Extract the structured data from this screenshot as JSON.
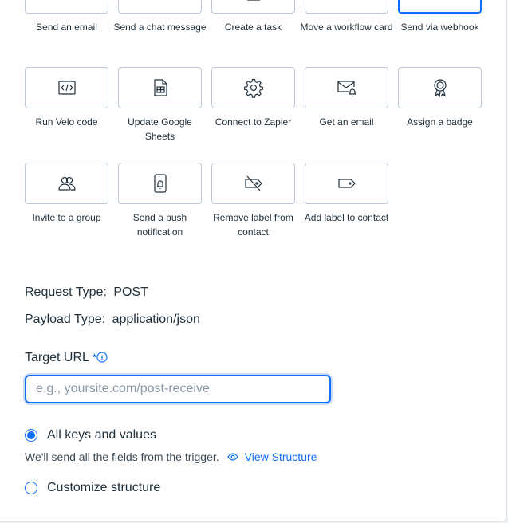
{
  "actions": [
    {
      "label": "Send an email",
      "icon": "envelope-icon",
      "selected": false
    },
    {
      "label": "Send a chat message",
      "icon": "chat-bubble-icon",
      "selected": false
    },
    {
      "label": "Create a task",
      "icon": "task-icon",
      "selected": false
    },
    {
      "label": "Move a workflow card",
      "icon": "workflow-card-icon",
      "selected": false
    },
    {
      "label": "Send via webhook",
      "icon": "webhook-icon",
      "selected": true
    },
    {
      "label": "Run Velo code",
      "icon": "code-icon",
      "selected": false
    },
    {
      "label": "Update Google Sheets",
      "icon": "spreadsheet-icon",
      "selected": false
    },
    {
      "label": "Connect to Zapier",
      "icon": "gear-icon",
      "selected": false
    },
    {
      "label": "Get an email",
      "icon": "envelope-bell-icon",
      "selected": false
    },
    {
      "label": "Assign a badge",
      "icon": "badge-icon",
      "selected": false
    },
    {
      "label": "Invite to a group",
      "icon": "group-icon",
      "selected": false
    },
    {
      "label": "Send a push notification",
      "icon": "phone-bell-icon",
      "selected": false
    },
    {
      "label": "Remove label from contact",
      "icon": "label-remove-icon",
      "selected": false
    },
    {
      "label": "Add label to contact",
      "icon": "label-icon",
      "selected": false
    }
  ],
  "request_type": {
    "label": "Request Type:",
    "value": "POST"
  },
  "payload_type": {
    "label": "Payload Type:",
    "value": "application/json"
  },
  "target_url": {
    "label": "Target URL",
    "required_mark": "*",
    "placeholder": "e.g., yoursite.com/post-receive",
    "value": ""
  },
  "structure": {
    "option_all": "All keys and values",
    "option_all_selected": true,
    "helper": "We'll send all the fields from the trigger.",
    "view_link": "View Structure",
    "option_custom": "Customize structure"
  },
  "colors": {
    "accent": "#116dff",
    "border": "#bcc8d6",
    "text": "#20303c"
  }
}
